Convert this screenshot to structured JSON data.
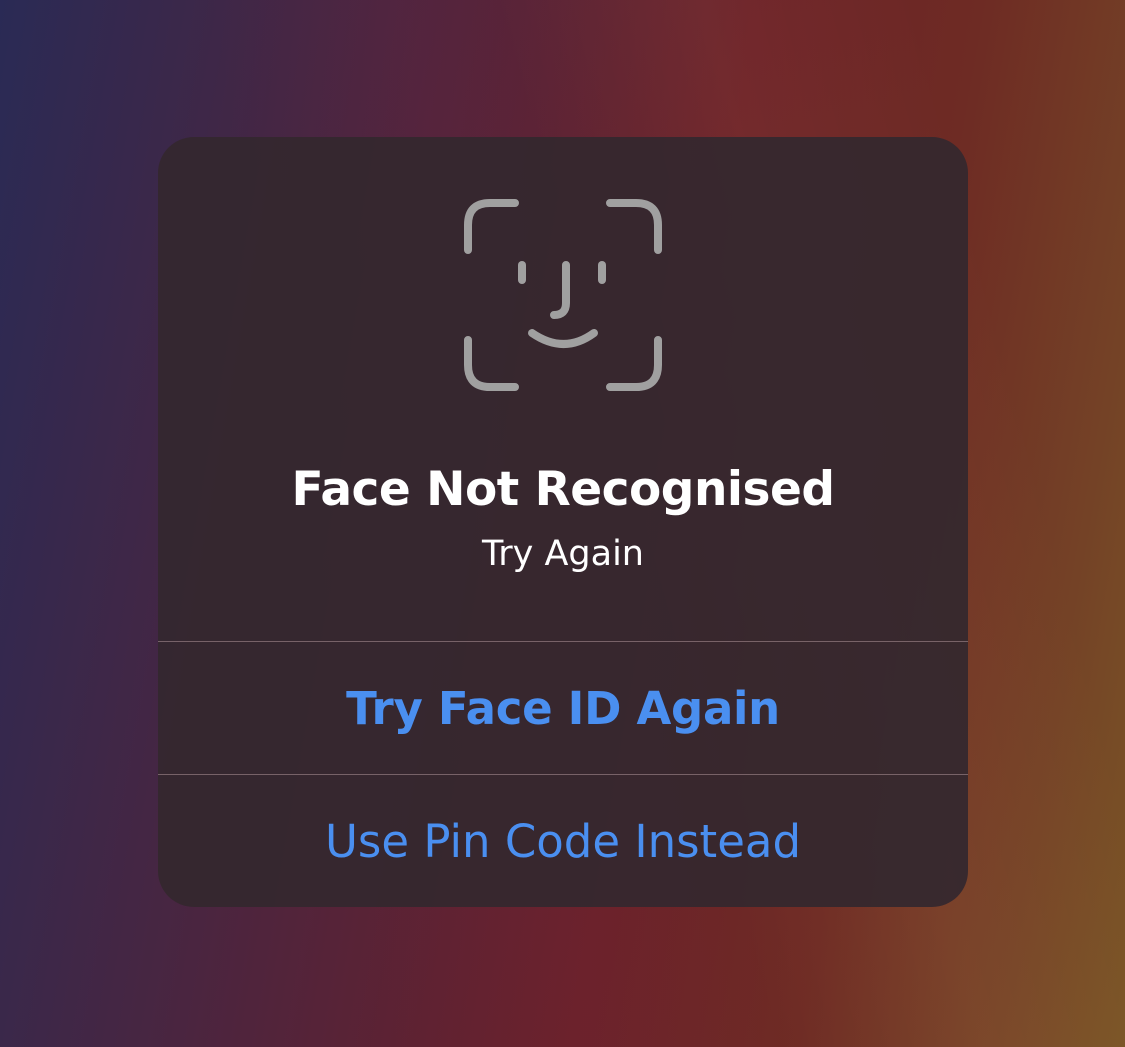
{
  "alert": {
    "icon": "face-id-icon",
    "title": "Face Not Recognised",
    "message": "Try Again",
    "actions": {
      "primary": "Try Face ID Again",
      "secondary": "Use Pin Code Instead"
    }
  },
  "colors": {
    "accent": "#4a8ff0",
    "icon": "#a0a0a0",
    "text": "#ffffff"
  }
}
